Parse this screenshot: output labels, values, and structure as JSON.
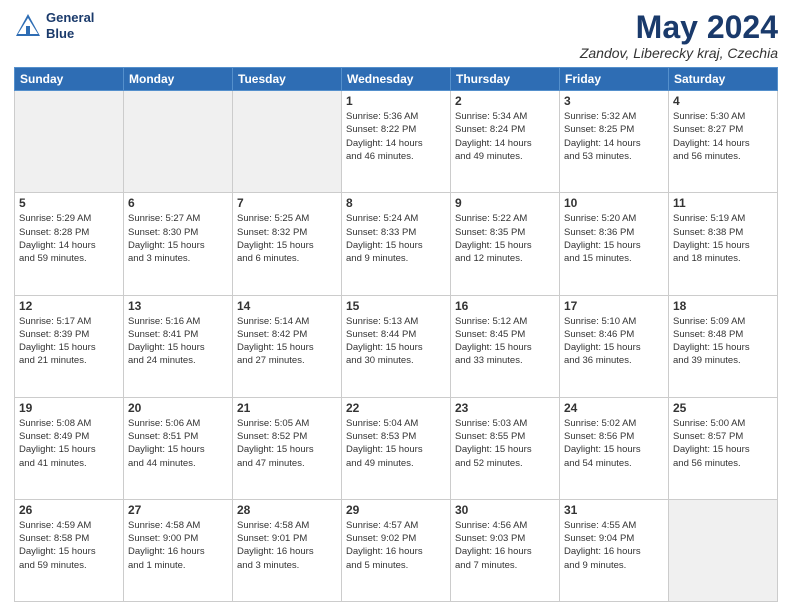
{
  "header": {
    "logo": {
      "line1": "General",
      "line2": "Blue"
    },
    "title": "May 2024",
    "subtitle": "Zandov, Liberecky kraj, Czechia"
  },
  "weekdays": [
    "Sunday",
    "Monday",
    "Tuesday",
    "Wednesday",
    "Thursday",
    "Friday",
    "Saturday"
  ],
  "weeks": [
    [
      {
        "day": "",
        "empty": true
      },
      {
        "day": "",
        "empty": true
      },
      {
        "day": "",
        "empty": true
      },
      {
        "day": "1",
        "lines": [
          "Sunrise: 5:36 AM",
          "Sunset: 8:22 PM",
          "Daylight: 14 hours",
          "and 46 minutes."
        ]
      },
      {
        "day": "2",
        "lines": [
          "Sunrise: 5:34 AM",
          "Sunset: 8:24 PM",
          "Daylight: 14 hours",
          "and 49 minutes."
        ]
      },
      {
        "day": "3",
        "lines": [
          "Sunrise: 5:32 AM",
          "Sunset: 8:25 PM",
          "Daylight: 14 hours",
          "and 53 minutes."
        ]
      },
      {
        "day": "4",
        "lines": [
          "Sunrise: 5:30 AM",
          "Sunset: 8:27 PM",
          "Daylight: 14 hours",
          "and 56 minutes."
        ]
      }
    ],
    [
      {
        "day": "5",
        "lines": [
          "Sunrise: 5:29 AM",
          "Sunset: 8:28 PM",
          "Daylight: 14 hours",
          "and 59 minutes."
        ]
      },
      {
        "day": "6",
        "lines": [
          "Sunrise: 5:27 AM",
          "Sunset: 8:30 PM",
          "Daylight: 15 hours",
          "and 3 minutes."
        ]
      },
      {
        "day": "7",
        "lines": [
          "Sunrise: 5:25 AM",
          "Sunset: 8:32 PM",
          "Daylight: 15 hours",
          "and 6 minutes."
        ]
      },
      {
        "day": "8",
        "lines": [
          "Sunrise: 5:24 AM",
          "Sunset: 8:33 PM",
          "Daylight: 15 hours",
          "and 9 minutes."
        ]
      },
      {
        "day": "9",
        "lines": [
          "Sunrise: 5:22 AM",
          "Sunset: 8:35 PM",
          "Daylight: 15 hours",
          "and 12 minutes."
        ]
      },
      {
        "day": "10",
        "lines": [
          "Sunrise: 5:20 AM",
          "Sunset: 8:36 PM",
          "Daylight: 15 hours",
          "and 15 minutes."
        ]
      },
      {
        "day": "11",
        "lines": [
          "Sunrise: 5:19 AM",
          "Sunset: 8:38 PM",
          "Daylight: 15 hours",
          "and 18 minutes."
        ]
      }
    ],
    [
      {
        "day": "12",
        "lines": [
          "Sunrise: 5:17 AM",
          "Sunset: 8:39 PM",
          "Daylight: 15 hours",
          "and 21 minutes."
        ]
      },
      {
        "day": "13",
        "lines": [
          "Sunrise: 5:16 AM",
          "Sunset: 8:41 PM",
          "Daylight: 15 hours",
          "and 24 minutes."
        ]
      },
      {
        "day": "14",
        "lines": [
          "Sunrise: 5:14 AM",
          "Sunset: 8:42 PM",
          "Daylight: 15 hours",
          "and 27 minutes."
        ]
      },
      {
        "day": "15",
        "lines": [
          "Sunrise: 5:13 AM",
          "Sunset: 8:44 PM",
          "Daylight: 15 hours",
          "and 30 minutes."
        ]
      },
      {
        "day": "16",
        "lines": [
          "Sunrise: 5:12 AM",
          "Sunset: 8:45 PM",
          "Daylight: 15 hours",
          "and 33 minutes."
        ]
      },
      {
        "day": "17",
        "lines": [
          "Sunrise: 5:10 AM",
          "Sunset: 8:46 PM",
          "Daylight: 15 hours",
          "and 36 minutes."
        ]
      },
      {
        "day": "18",
        "lines": [
          "Sunrise: 5:09 AM",
          "Sunset: 8:48 PM",
          "Daylight: 15 hours",
          "and 39 minutes."
        ]
      }
    ],
    [
      {
        "day": "19",
        "lines": [
          "Sunrise: 5:08 AM",
          "Sunset: 8:49 PM",
          "Daylight: 15 hours",
          "and 41 minutes."
        ]
      },
      {
        "day": "20",
        "lines": [
          "Sunrise: 5:06 AM",
          "Sunset: 8:51 PM",
          "Daylight: 15 hours",
          "and 44 minutes."
        ]
      },
      {
        "day": "21",
        "lines": [
          "Sunrise: 5:05 AM",
          "Sunset: 8:52 PM",
          "Daylight: 15 hours",
          "and 47 minutes."
        ]
      },
      {
        "day": "22",
        "lines": [
          "Sunrise: 5:04 AM",
          "Sunset: 8:53 PM",
          "Daylight: 15 hours",
          "and 49 minutes."
        ]
      },
      {
        "day": "23",
        "lines": [
          "Sunrise: 5:03 AM",
          "Sunset: 8:55 PM",
          "Daylight: 15 hours",
          "and 52 minutes."
        ]
      },
      {
        "day": "24",
        "lines": [
          "Sunrise: 5:02 AM",
          "Sunset: 8:56 PM",
          "Daylight: 15 hours",
          "and 54 minutes."
        ]
      },
      {
        "day": "25",
        "lines": [
          "Sunrise: 5:00 AM",
          "Sunset: 8:57 PM",
          "Daylight: 15 hours",
          "and 56 minutes."
        ]
      }
    ],
    [
      {
        "day": "26",
        "lines": [
          "Sunrise: 4:59 AM",
          "Sunset: 8:58 PM",
          "Daylight: 15 hours",
          "and 59 minutes."
        ]
      },
      {
        "day": "27",
        "lines": [
          "Sunrise: 4:58 AM",
          "Sunset: 9:00 PM",
          "Daylight: 16 hours",
          "and 1 minute."
        ]
      },
      {
        "day": "28",
        "lines": [
          "Sunrise: 4:58 AM",
          "Sunset: 9:01 PM",
          "Daylight: 16 hours",
          "and 3 minutes."
        ]
      },
      {
        "day": "29",
        "lines": [
          "Sunrise: 4:57 AM",
          "Sunset: 9:02 PM",
          "Daylight: 16 hours",
          "and 5 minutes."
        ]
      },
      {
        "day": "30",
        "lines": [
          "Sunrise: 4:56 AM",
          "Sunset: 9:03 PM",
          "Daylight: 16 hours",
          "and 7 minutes."
        ]
      },
      {
        "day": "31",
        "lines": [
          "Sunrise: 4:55 AM",
          "Sunset: 9:04 PM",
          "Daylight: 16 hours",
          "and 9 minutes."
        ]
      },
      {
        "day": "",
        "empty": true
      }
    ]
  ]
}
